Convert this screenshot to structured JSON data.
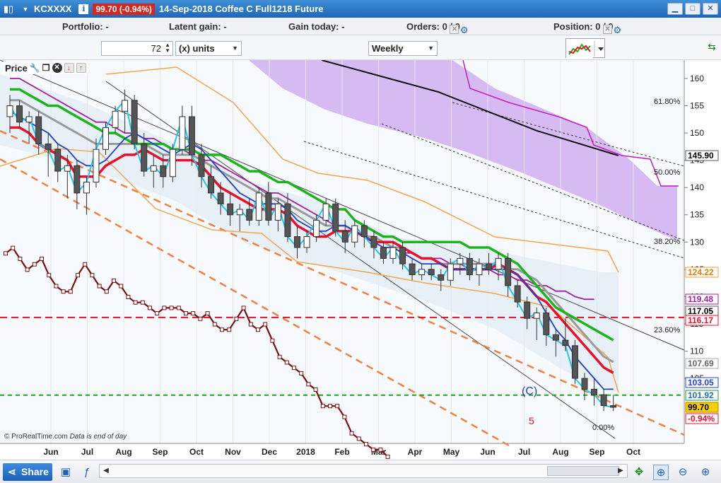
{
  "title_bar": {
    "symbol": "KCXXXX",
    "info_icon": "i",
    "price": "99.70 (-0.94%)",
    "description": "14-Sep-2018 Coffee C Full1218 Future"
  },
  "info_row": {
    "portfolio": "Portfolio: -",
    "latent_gain": "Latent gain: -",
    "gain_today": "Gain today: -",
    "orders": "Orders: 0",
    "orders_slash": "/ 0",
    "position": "Position: 0",
    "position_slash": "/ 0"
  },
  "controls": {
    "units_value": "72",
    "units_label": "(x) units",
    "timeframe": "Weekly"
  },
  "price_panel": {
    "label": "Price"
  },
  "colors": {
    "accent": "#1f66b8",
    "down": "#d7261e",
    "kumo": "#b07be0",
    "tenkan": "#e8102a",
    "kijun": "#1bb51b",
    "chikou": "#7a0f0f"
  },
  "chart_data": {
    "type": "candlestick",
    "y_axis": {
      "ticks": [
        "160",
        "155",
        "150",
        "145",
        "140",
        "135",
        "130",
        "125",
        "120",
        "115",
        "110",
        "105"
      ],
      "range": [
        98,
        163
      ]
    },
    "x_axis": {
      "ticks": [
        "Jun",
        "Jul",
        "Aug",
        "Sep",
        "Oct",
        "Nov",
        "Dec",
        "2018",
        "Feb",
        "Mar",
        "Apr",
        "May",
        "Jun",
        "Jul",
        "Aug",
        "Sep",
        "Oct"
      ]
    },
    "price_tags": [
      {
        "value": "145.90",
        "color": "#ffffff",
        "border": "#555555",
        "text": "#000000"
      },
      {
        "value": "124.22",
        "color": "#ffffff",
        "border": "#f0a030",
        "text": "#e08000"
      },
      {
        "value": "119.48",
        "color": "#ffffff",
        "border": "#a020a0",
        "text": "#a020a0"
      },
      {
        "value": "117.05",
        "color": "#ffffff",
        "border": "#555555",
        "text": "#000000"
      },
      {
        "value": "116.17",
        "color": "#ffffff",
        "border": "#e8102a",
        "text": "#e8102a"
      },
      {
        "value": "107.69",
        "color": "#ffffff",
        "border": "#aaaaaa",
        "text": "#666666"
      },
      {
        "value": "103.05",
        "color": "#ffffff",
        "border": "#1f3fd0",
        "text": "#1f3fd0"
      },
      {
        "value": "101.92",
        "color": "#ffffff",
        "border": "#15a515",
        "text": "#1e6fb0"
      },
      {
        "value": "99.70",
        "color": "#f6d000",
        "border": "#b08a00",
        "text": "#000000"
      },
      {
        "value": "-0.94%",
        "color": "#ffffff",
        "border": "#e8102a",
        "text": "#e8102a"
      }
    ],
    "fib_labels": [
      "61.80%",
      "50.00%",
      "38.20%",
      "23.60%",
      "0.00%"
    ],
    "annotations": [
      "(C)",
      "5"
    ],
    "candles_ohlc": [
      [
        153,
        157,
        150,
        155
      ],
      [
        155,
        156,
        151,
        152
      ],
      [
        152,
        154,
        148,
        153
      ],
      [
        153,
        154,
        146,
        148
      ],
      [
        148,
        150,
        142,
        147
      ],
      [
        147,
        148,
        141,
        143
      ],
      [
        143,
        146,
        138,
        144
      ],
      [
        144,
        145,
        136,
        139
      ],
      [
        139,
        142,
        135,
        141
      ],
      [
        141,
        149,
        140,
        147
      ],
      [
        147,
        152,
        146,
        151
      ],
      [
        151,
        155,
        150,
        154
      ],
      [
        154,
        158,
        150,
        156
      ],
      [
        156,
        157,
        147,
        148
      ],
      [
        148,
        150,
        142,
        143
      ],
      [
        143,
        146,
        140,
        144
      ],
      [
        144,
        146,
        140,
        142
      ],
      [
        142,
        148,
        141,
        147
      ],
      [
        147,
        155,
        146,
        153
      ],
      [
        153,
        155,
        144,
        146
      ],
      [
        146,
        148,
        140,
        142
      ],
      [
        142,
        144,
        138,
        139
      ],
      [
        139,
        141,
        135,
        137
      ],
      [
        137,
        139,
        133,
        135
      ],
      [
        135,
        137,
        132,
        136
      ],
      [
        136,
        138,
        133,
        134
      ],
      [
        134,
        140,
        133,
        139
      ],
      [
        139,
        141,
        133,
        134
      ],
      [
        134,
        138,
        132,
        137
      ],
      [
        137,
        139,
        130,
        131
      ],
      [
        131,
        133,
        127,
        129
      ],
      [
        129,
        132,
        128,
        131
      ],
      [
        131,
        135,
        130,
        134
      ],
      [
        134,
        138,
        133,
        137
      ],
      [
        137,
        138,
        131,
        132
      ],
      [
        132,
        134,
        128,
        130
      ],
      [
        130,
        134,
        129,
        133
      ],
      [
        133,
        134,
        129,
        131
      ],
      [
        131,
        132,
        127,
        129
      ],
      [
        129,
        130,
        126,
        127
      ],
      [
        127,
        130,
        126,
        129
      ],
      [
        129,
        130,
        125,
        126
      ],
      [
        126,
        127,
        123,
        124
      ],
      [
        124,
        126,
        123,
        125
      ],
      [
        125,
        126,
        123,
        124
      ],
      [
        124,
        125,
        121,
        123
      ],
      [
        123,
        127,
        122,
        126
      ],
      [
        126,
        128,
        124,
        127
      ],
      [
        127,
        128,
        123,
        124
      ],
      [
        124,
        127,
        122,
        126
      ],
      [
        126,
        128,
        124,
        125
      ],
      [
        125,
        128,
        123,
        127
      ],
      [
        127,
        128,
        120,
        122
      ],
      [
        122,
        123,
        118,
        119
      ],
      [
        119,
        120,
        114,
        116
      ],
      [
        116,
        118,
        112,
        117
      ],
      [
        117,
        118,
        111,
        113
      ],
      [
        113,
        114,
        109,
        112
      ],
      [
        112,
        116,
        110,
        111
      ],
      [
        111,
        112,
        104,
        105
      ],
      [
        105,
        106,
        101,
        103
      ],
      [
        103,
        105,
        100,
        102
      ],
      [
        102,
        103,
        99,
        100
      ],
      [
        100,
        102,
        99,
        99.7
      ]
    ],
    "tenkan": [
      151,
      151,
      150,
      148,
      147,
      146,
      145,
      142,
      142,
      142,
      144,
      145,
      146,
      146,
      147,
      146,
      145,
      145,
      145,
      145,
      144,
      142,
      140,
      139,
      138,
      137,
      136,
      136,
      136,
      135,
      133,
      132,
      131,
      131,
      132,
      132,
      132,
      131,
      130,
      130,
      130,
      129,
      128,
      127,
      127,
      126,
      125,
      125,
      125,
      125,
      125,
      126,
      125,
      124,
      122,
      120,
      119,
      117,
      115,
      113,
      111,
      109,
      107,
      106
    ],
    "kijun": [
      158,
      158,
      157,
      156,
      155,
      155,
      154,
      153,
      152,
      151,
      150,
      150,
      149,
      148,
      148,
      148,
      148,
      147,
      147,
      147,
      146,
      146,
      146,
      145,
      144,
      143,
      143,
      142,
      141,
      141,
      140,
      139,
      138,
      137,
      136,
      136,
      134,
      133,
      132,
      131,
      131,
      130,
      130,
      130,
      130,
      130,
      130,
      130,
      129,
      129,
      129,
      128,
      127,
      126,
      124,
      122,
      120,
      118,
      117,
      116,
      115,
      114,
      113,
      112
    ],
    "ma_blue": [
      154,
      153,
      152,
      151,
      150,
      148,
      147,
      145,
      144,
      144,
      145,
      147,
      149,
      150,
      149,
      148,
      147,
      146,
      147,
      148,
      147,
      145,
      143,
      141,
      139,
      138,
      137,
      137,
      137,
      136,
      134,
      133,
      132,
      132,
      133,
      133,
      132,
      131,
      130,
      129,
      129,
      128,
      127,
      126,
      126,
      126,
      125,
      125,
      125,
      125,
      125,
      125,
      125,
      124,
      122,
      120,
      117,
      114,
      112,
      109,
      107,
      105,
      103,
      103
    ],
    "ma_gray": [
      156,
      156,
      155,
      154,
      153,
      152,
      151,
      150,
      149,
      148,
      148,
      148,
      148,
      148,
      148,
      147,
      146,
      146,
      146,
      146,
      145,
      144,
      143,
      142,
      141,
      140,
      139,
      138,
      138,
      137,
      136,
      135,
      134,
      133,
      133,
      133,
      132,
      131,
      131,
      130,
      129,
      129,
      128,
      127,
      127,
      126,
      126,
      126,
      126,
      126,
      126,
      126,
      125,
      125,
      124,
      123,
      121,
      119,
      117,
      115,
      113,
      111,
      109,
      108
    ],
    "ma_purple": [
      160,
      160,
      159,
      158,
      157,
      156,
      155,
      154,
      153,
      152,
      152,
      151,
      150,
      150,
      149,
      149,
      148,
      147,
      147,
      146,
      145,
      145,
      144,
      143,
      142,
      141,
      140,
      139,
      139,
      138,
      137,
      136,
      135,
      134,
      133,
      133,
      132,
      131,
      130,
      130,
      129,
      128,
      128,
      127,
      127,
      127,
      126,
      126,
      125,
      125,
      125,
      124,
      124,
      123,
      123,
      122,
      122,
      121,
      121,
      120,
      119.5,
      119.5
    ],
    "chikou": [
      137,
      138,
      136,
      134,
      135,
      136,
      133,
      131,
      130,
      130,
      133,
      135,
      133,
      131,
      130,
      132,
      131,
      129,
      128,
      128,
      127,
      126,
      127,
      127,
      127,
      126,
      126,
      125,
      126,
      124,
      123,
      123,
      125,
      127,
      124,
      123,
      124,
      121,
      118,
      117,
      116,
      115,
      113,
      112,
      109,
      109,
      109,
      107,
      104,
      103,
      102,
      101,
      101,
      99.7
    ]
  },
  "footer": {
    "credit": "© ProRealTime.com",
    "note": "Data is end of day"
  },
  "bottom_bar": {
    "share_label": "Share"
  }
}
